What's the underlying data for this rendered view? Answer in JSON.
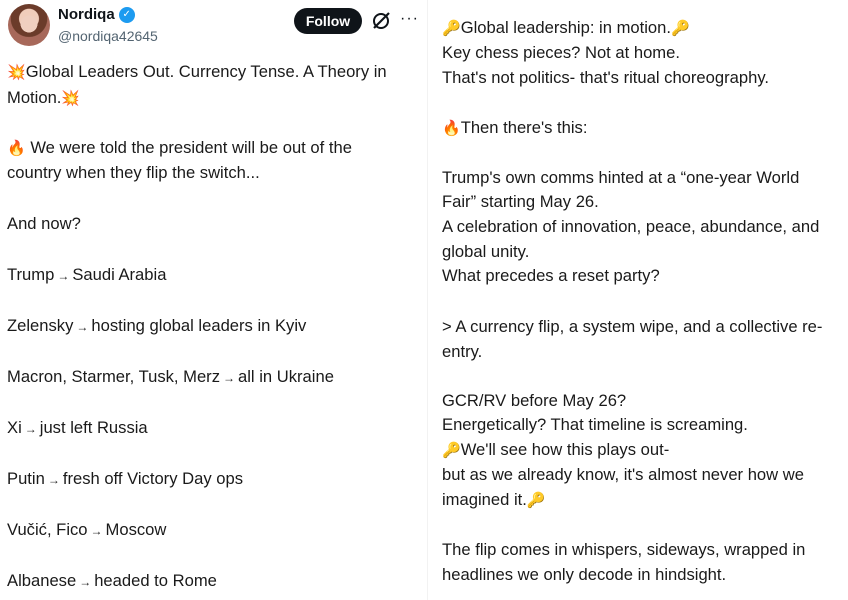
{
  "author": {
    "name": "Nordiqa",
    "handle": "@nordiqa42645",
    "follow_label": "Follow",
    "more_label": "···"
  },
  "emoji": {
    "boom": "💥",
    "fire": "🔥",
    "key": "🔑"
  },
  "left": {
    "title_1": "Global Leaders Out. Currency Tense. A Theory in",
    "title_2": "Motion.",
    "intro_1": "We were told the president will be out of the",
    "intro_2": "country when they flip the switch...",
    "and_now": "And now?",
    "list": [
      {
        "who": "Trump",
        "where": "Saudi Arabia"
      },
      {
        "who": "Zelensky",
        "where": "hosting global leaders in Kyiv"
      },
      {
        "who": "Macron, Starmer, Tusk, Merz",
        "where": "all in Ukraine"
      },
      {
        "who": "Xi",
        "where": "just left Russia"
      },
      {
        "who": "Putin",
        "where": "fresh off Victory Day ops"
      },
      {
        "who": "Vučić, Fico",
        "where": "Moscow"
      },
      {
        "who": "Albanese",
        "where": "headed to Rome"
      }
    ],
    "arrow": "→"
  },
  "right": {
    "line1": "Global leadership: in motion.",
    "line2": "Key chess pieces? Not at home.",
    "line3": "That's not politics- that's ritual choreography.",
    "line4": "Then there's this:",
    "line5": "Trump's own comms hinted at a “one-year World",
    "line6": "Fair” starting May 26.",
    "line7": "A celebration of innovation, peace, abundance, and",
    "line8": "global unity.",
    "line9": "What precedes a reset party?",
    "line10": "> A currency flip, a system wipe, and a collective re-",
    "line11": "entry.",
    "line12": "GCR/RV before May 26?",
    "line13": "Energetically? That timeline is screaming.",
    "line14": "We'll see how this plays out-",
    "line15": "but as we already know, it's almost never how we",
    "line16": "imagined it.",
    "line17": "The flip comes in whispers, sideways, wrapped in",
    "line18": "headlines we only decode in hindsight."
  }
}
